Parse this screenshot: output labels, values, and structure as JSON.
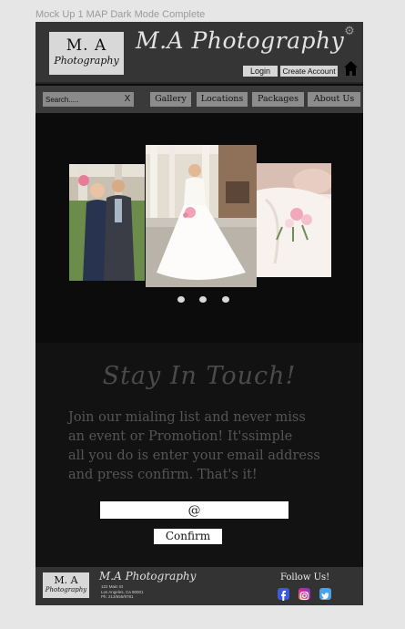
{
  "frame_label": "Mock Up 1 MAP Dark Mode Complete",
  "header": {
    "logo_main": "M. A",
    "logo_sub": "Photography",
    "brand_title": "M.A Photography",
    "login_label": "Login",
    "create_account_label": "Create Account"
  },
  "nav": {
    "search_placeholder": "Search.....",
    "search_clear": "X",
    "items": [
      {
        "label": "Gallery"
      },
      {
        "label": "Locations"
      },
      {
        "label": "Packages"
      },
      {
        "label": "About Us"
      }
    ]
  },
  "carousel": {
    "slide_count": 3
  },
  "signup": {
    "heading": "Stay In Touch!",
    "body": "Join our mialing list and never miss\nan event or Promotion! It'ssimple\nall you do is enter your email  address\n and press confirm. That's it!",
    "email_placeholder": "@",
    "confirm_label": "Confirm"
  },
  "footer": {
    "logo_main": "M. A",
    "logo_sub": "Photography",
    "brand": "M.A Photography",
    "address_line1": "122 Main St",
    "address_line2": "Los Angeles, Ca 90001",
    "phone": "Ph: 213/555/9781",
    "follow_label": "Follow Us!"
  },
  "colors": {
    "background": "#0c0c0c",
    "header": "#353535",
    "nav_button": "#8c8c8c"
  }
}
